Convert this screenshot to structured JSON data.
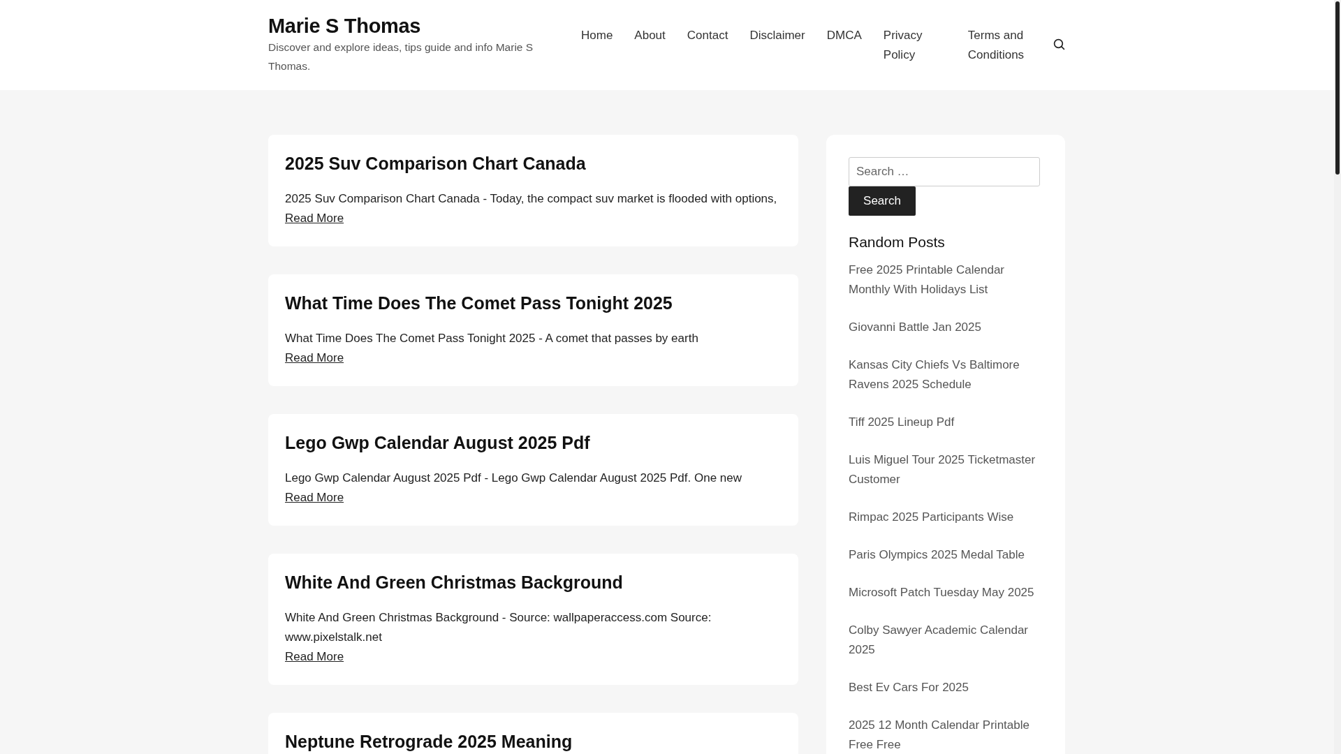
{
  "site": {
    "title": "Marie S Thomas",
    "tagline": "Discover and explore ideas, tips guide and info Marie S Thomas."
  },
  "nav": [
    {
      "label": "Home"
    },
    {
      "label": "About"
    },
    {
      "label": "Contact"
    },
    {
      "label": "Disclaimer"
    },
    {
      "label": "DMCA"
    },
    {
      "label": "Privacy Policy"
    },
    {
      "label": "Terms and Conditions"
    }
  ],
  "posts": [
    {
      "title": "2025 Suv Comparison Chart Canada",
      "excerpt": "2025 Suv Comparison Chart Canada - Today, the compact suv market is flooded with options,",
      "read_more": "Read More"
    },
    {
      "title": "What Time Does The Comet Pass Tonight 2025",
      "excerpt": "What Time Does The Comet Pass Tonight 2025 - A comet that passes by earth",
      "read_more": "Read More"
    },
    {
      "title": "Lego Gwp Calendar August 2025 Pdf",
      "excerpt": "Lego Gwp Calendar August 2025 Pdf - Lego Gwp Calendar August 2025 Pdf. One new",
      "read_more": "Read More"
    },
    {
      "title": "White And Green Christmas Background",
      "excerpt": "White And Green Christmas Background - Source: wallpaperaccess.com Source: www.pixelstalk.net",
      "read_more": "Read More"
    },
    {
      "title": "Neptune Retrograde 2025 Meaning"
    }
  ],
  "sidebar": {
    "search": {
      "placeholder": "Search …",
      "button": "Search"
    },
    "heading": "Random Posts",
    "items": [
      "Free 2025 Printable Calendar Monthly With Holidays List",
      "Giovanni Battle Jan 2025",
      "Kansas City Chiefs Vs Baltimore Ravens 2025 Schedule",
      "Tiff 2025 Lineup Pdf",
      "Luis Miguel Tour 2025 Ticketmaster Customer",
      "Rimpac 2025 Participants Wise",
      "Paris Olympics 2025 Medal Table",
      "Microsoft Patch Tuesday May 2025",
      "Colby Sawyer Academic Calendar 2025",
      "Best Ev Cars For 2025",
      "2025 12 Month Calendar Printable Free Free"
    ]
  }
}
